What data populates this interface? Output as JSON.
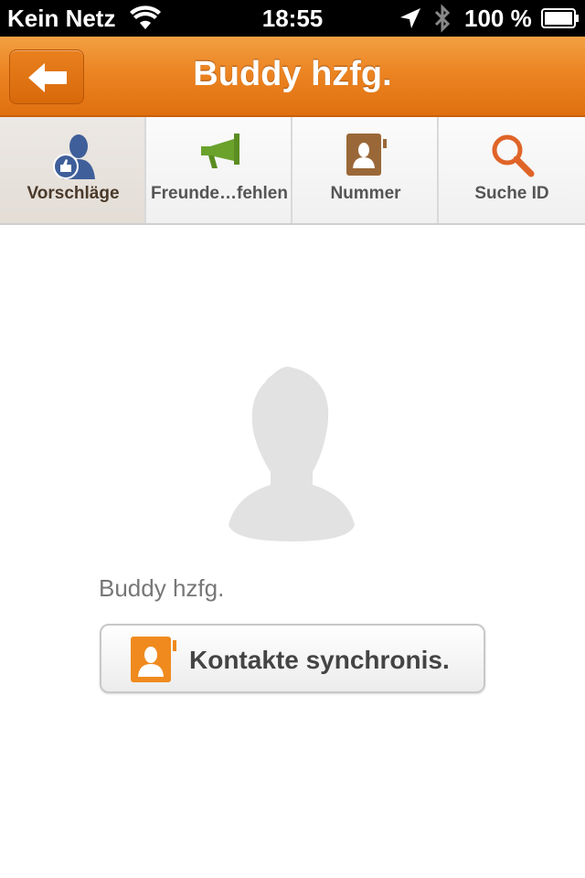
{
  "status_bar": {
    "carrier": "Kein Netz",
    "time": "18:55",
    "battery_percent": "100 %",
    "icons": [
      "wifi-icon",
      "location-icon",
      "bluetooth-icon",
      "battery-icon"
    ]
  },
  "nav": {
    "title": "Buddy hzfg.",
    "back_icon": "arrow-left-icon",
    "color": "#ec8422"
  },
  "tabs": [
    {
      "label": "Vorschläge",
      "icon": "thumbs-up-person-icon",
      "active": true
    },
    {
      "label": "Freunde…fehlen",
      "icon": "megaphone-icon",
      "active": false
    },
    {
      "label": "Nummer",
      "icon": "address-book-icon",
      "active": false
    },
    {
      "label": "Suche ID",
      "icon": "magnifier-icon",
      "active": false
    }
  ],
  "profile": {
    "name": "Buddy hzfg.",
    "avatar_icon": "default-avatar-icon"
  },
  "sync_button": {
    "label": "Kontakte synchronis.",
    "icon": "contacts-icon",
    "icon_color": "#f08a1e"
  }
}
